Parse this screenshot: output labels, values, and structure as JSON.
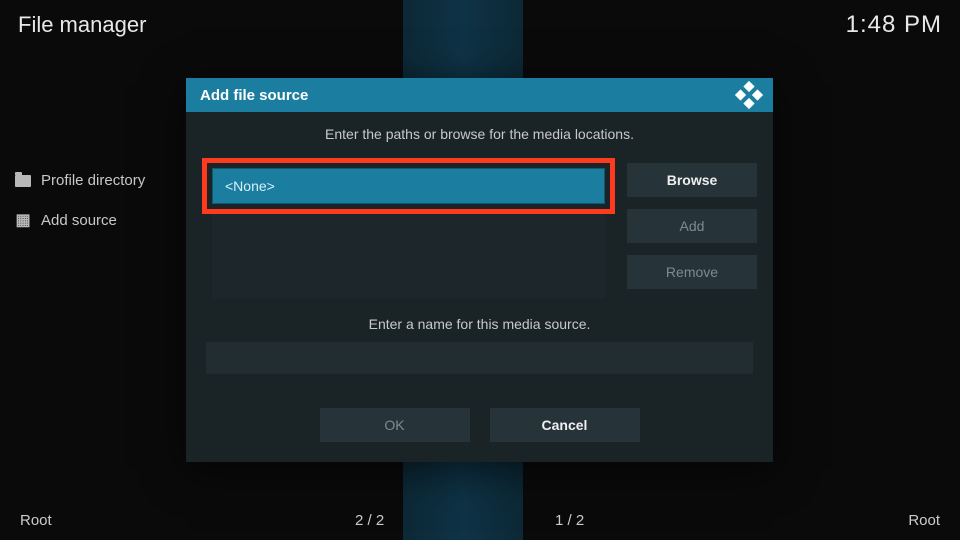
{
  "header": {
    "title": "File manager",
    "time": "1:48 PM"
  },
  "sidebar": {
    "items": [
      {
        "label": "Profile directory"
      },
      {
        "label": "Add source"
      }
    ]
  },
  "footer": {
    "left": "Root",
    "centerLeft": "2 / 2",
    "centerRight": "1 / 2",
    "right": "Root"
  },
  "dialog": {
    "title": "Add file source",
    "pathsInstruction": "Enter the paths or browse for the media locations.",
    "pathValue": "<None>",
    "browseLabel": "Browse",
    "addLabel": "Add",
    "removeLabel": "Remove",
    "nameInstruction": "Enter a name for this media source.",
    "nameValue": "",
    "okLabel": "OK",
    "cancelLabel": "Cancel"
  }
}
